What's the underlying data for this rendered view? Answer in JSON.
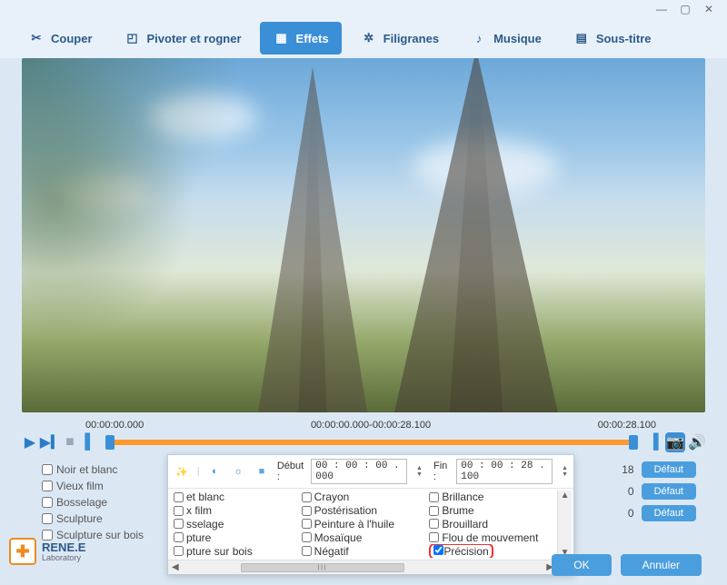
{
  "tabs": {
    "cut": "Couper",
    "rotate": "Pivoter et rogner",
    "effects": "Effets",
    "watermark": "Filigranes",
    "music": "Musique",
    "subtitle": "Sous-titre"
  },
  "timeline": {
    "start": "00:00:00.000",
    "range": "00:00:00.000-00:00:28.100",
    "end": "00:00:28.100"
  },
  "bg_effects_left": [
    "Noir et blanc",
    "Vieux film",
    "Bosselage",
    "Sculpture",
    "Sculpture sur bois"
  ],
  "bg_right_values": [
    "18",
    "0",
    "0"
  ],
  "buttons": {
    "default": "Défaut",
    "ok": "OK",
    "cancel": "Annuler"
  },
  "popup": {
    "debut_label": "Début :",
    "debut_value": "00 : 00 : 00 . 000",
    "fin_label": "Fin :",
    "fin_value": "00 : 00 : 28 . 100",
    "col1": [
      "et blanc",
      "x film",
      "sselage",
      "pture",
      "pture sur bois"
    ],
    "col2": [
      "Crayon",
      "Postérisation",
      "Peinture à l'huile",
      "Mosaïque",
      "Négatif"
    ],
    "col3": [
      "Brillance",
      "Brume",
      "Brouillard",
      "Flou de mouvement",
      "Précision"
    ],
    "precision_checked": true
  },
  "logo": {
    "line1": "RENE.E",
    "line2": "Laboratory"
  }
}
